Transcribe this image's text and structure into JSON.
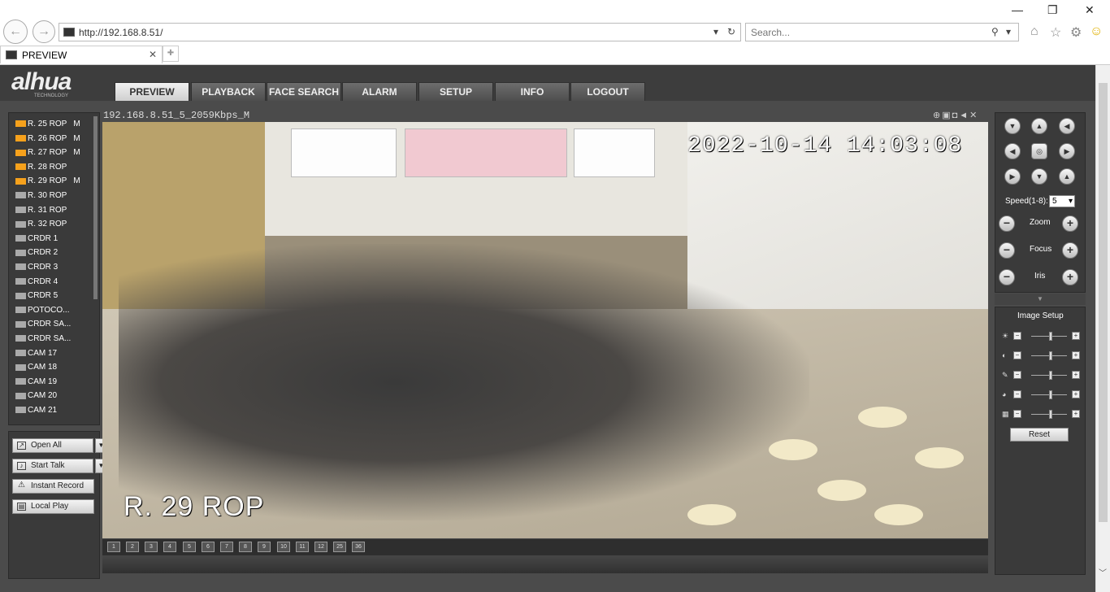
{
  "browser": {
    "url": "http://192.168.8.51/",
    "search_placeholder": "Search...",
    "tab_title": "PREVIEW",
    "back_icon": "back-arrow-icon",
    "forward_icon": "forward-arrow-icon"
  },
  "menu": {
    "tabs": [
      {
        "label": "PREVIEW",
        "active": true
      },
      {
        "label": "PLAYBACK"
      },
      {
        "label": "FACE SEARCH"
      },
      {
        "label": "ALARM"
      },
      {
        "label": "SETUP"
      },
      {
        "label": "INFO"
      },
      {
        "label": "LOGOUT"
      }
    ]
  },
  "logo": {
    "brand": "alhua",
    "sub": "TECHNOLOGY"
  },
  "devices": [
    {
      "label": "R. 25 ROP",
      "stream": "M",
      "active": true
    },
    {
      "label": "R. 26 ROP",
      "stream": "M",
      "active": true
    },
    {
      "label": "R. 27 ROP",
      "stream": "M",
      "active": true
    },
    {
      "label": "R. 28 ROP",
      "stream": "",
      "active": true
    },
    {
      "label": "R. 29 ROP",
      "stream": "M",
      "active": true
    },
    {
      "label": "R. 30 ROP",
      "stream": "",
      "active": false
    },
    {
      "label": "R. 31 ROP",
      "stream": "",
      "active": false
    },
    {
      "label": "R. 32 ROP",
      "stream": "",
      "active": false
    },
    {
      "label": "CRDR 1",
      "stream": "",
      "active": false
    },
    {
      "label": "CRDR 2",
      "stream": "",
      "active": false
    },
    {
      "label": "CRDR 3",
      "stream": "",
      "active": false
    },
    {
      "label": "CRDR 4",
      "stream": "",
      "active": false
    },
    {
      "label": "CRDR 5",
      "stream": "",
      "active": false
    },
    {
      "label": "POTOCO...",
      "stream": "",
      "active": false
    },
    {
      "label": "CRDR SA...",
      "stream": "",
      "active": false
    },
    {
      "label": "CRDR SA...",
      "stream": "",
      "active": false
    },
    {
      "label": "CAM 17",
      "stream": "",
      "active": false
    },
    {
      "label": "CAM 18",
      "stream": "",
      "active": false
    },
    {
      "label": "CAM 19",
      "stream": "",
      "active": false
    },
    {
      "label": "CAM 20",
      "stream": "",
      "active": false
    },
    {
      "label": "CAM 21",
      "stream": "",
      "active": false
    }
  ],
  "actions": {
    "open_all": "Open All",
    "start_talk": "Start Talk",
    "instant_record": "Instant Record",
    "local_play": "Local Play"
  },
  "video": {
    "title": "192.168.8.51_5_2059Kbps_M",
    "timestamp": "2022-10-14 14:03:08",
    "channel_name": "R. 29 ROP"
  },
  "layout_buttons": [
    "1",
    "2",
    "3",
    "4",
    "5",
    "6",
    "7",
    "8",
    "9",
    "10",
    "11",
    "12",
    "25",
    "36"
  ],
  "ptz": {
    "speed_label": "Speed(1-8):",
    "speed_value": "5",
    "zoom_label": "Zoom",
    "focus_label": "Focus",
    "iris_label": "Iris"
  },
  "image_setup": {
    "title": "Image Setup",
    "reset_label": "Reset",
    "sliders": [
      {
        "icon": "brightness-icon",
        "value": 0.55
      },
      {
        "icon": "contrast-icon",
        "value": 0.55
      },
      {
        "icon": "saturation-icon",
        "value": 0.55
      },
      {
        "icon": "hue-icon",
        "value": 0.55
      },
      {
        "icon": "gain-icon",
        "value": 0.55
      }
    ]
  }
}
